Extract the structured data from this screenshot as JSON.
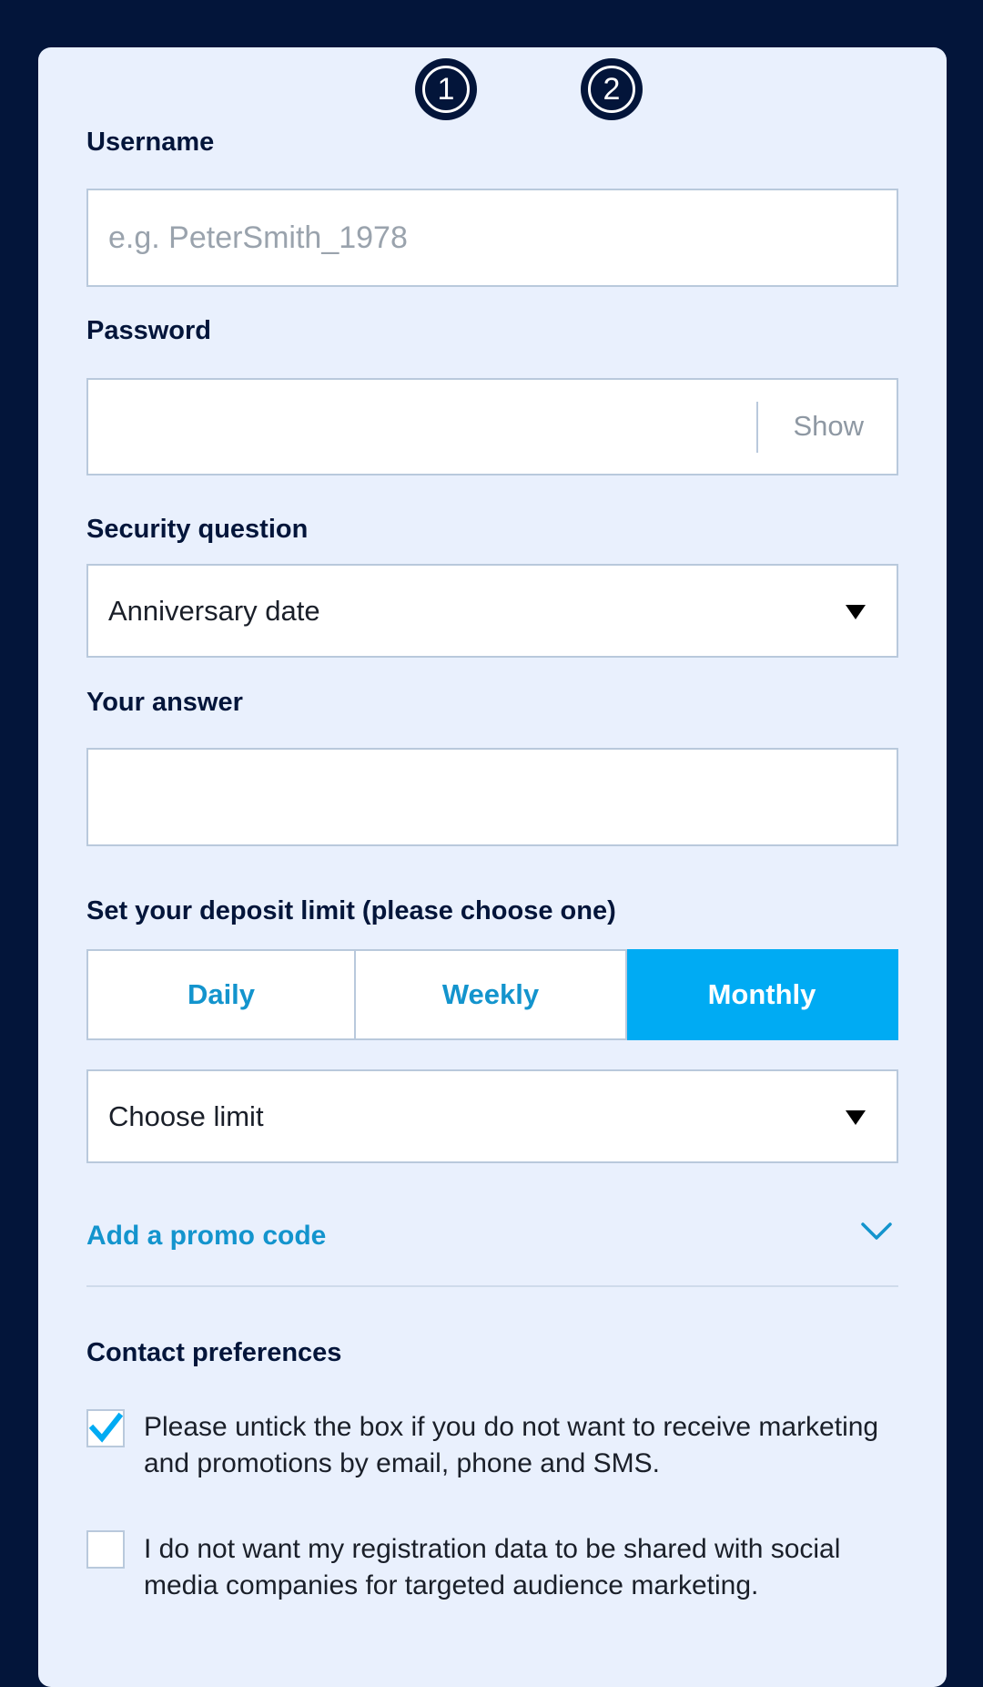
{
  "steps": [
    "1",
    "2"
  ],
  "username": {
    "label": "Username",
    "placeholder": "e.g. PeterSmith_1978"
  },
  "password": {
    "label": "Password",
    "show_label": "Show"
  },
  "security": {
    "label": "Security question",
    "selected": "Anniversary date"
  },
  "answer": {
    "label": "Your answer"
  },
  "deposit": {
    "label": "Set your deposit limit (please choose one)",
    "options": [
      "Daily",
      "Weekly",
      "Monthly"
    ],
    "selected": "Monthly",
    "limit_selected": "Choose limit"
  },
  "promo": {
    "label": "Add a promo code"
  },
  "contact": {
    "title": "Contact preferences",
    "options": [
      {
        "text": "Please untick the box if you do not want to receive marketing and promotions by email, phone and SMS.",
        "checked": true
      },
      {
        "text": "I do not want my registration data to be shared with social media companies for targeted audience marketing.",
        "checked": false
      }
    ]
  },
  "colors": {
    "background": "#03153a",
    "card": "#e9f0fd",
    "accent": "#00abf3",
    "link": "#1394cd"
  }
}
